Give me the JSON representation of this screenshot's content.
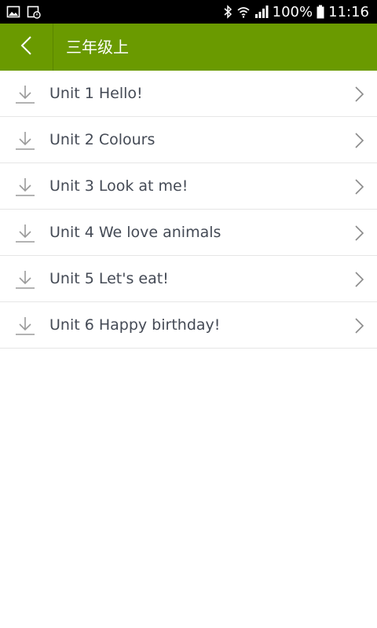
{
  "status_bar": {
    "battery_percent": "100%",
    "time": "11:16",
    "left_icons": [
      "image-icon",
      "calendar-alarm-icon"
    ],
    "right_icons": [
      "bluetooth-icon",
      "wifi-icon",
      "signal-icon",
      "battery-icon"
    ]
  },
  "header": {
    "title": "三年级上",
    "background_color": "#6a9a00",
    "back_icon": "chevron-left-icon"
  },
  "units": [
    {
      "label": "Unit 1 Hello!"
    },
    {
      "label": "Unit 2 Colours"
    },
    {
      "label": "Unit 3 Look at me!"
    },
    {
      "label": "Unit 4 We love animals"
    },
    {
      "label": "Unit 5 Let's eat!"
    },
    {
      "label": "Unit 6 Happy birthday!"
    }
  ],
  "row_icons": {
    "leading": "download-icon",
    "trailing": "chevron-right-icon"
  }
}
